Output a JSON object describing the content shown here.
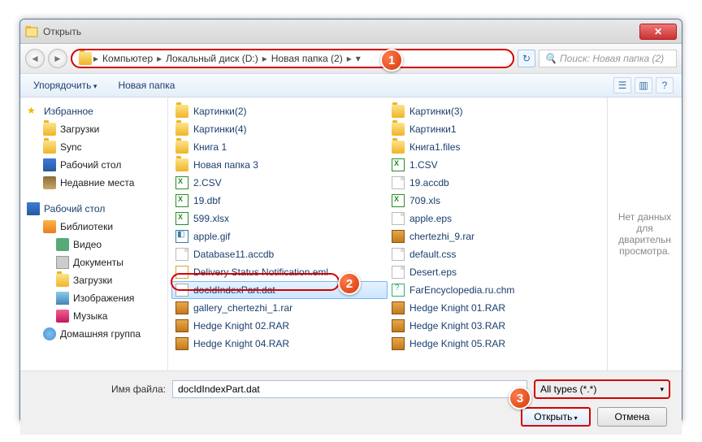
{
  "window": {
    "title": "Открыть"
  },
  "nav": {
    "crumbs": [
      "Компьютер",
      "Локальный диск (D:)",
      "Новая папка (2)"
    ],
    "search_placeholder": "Поиск: Новая папка (2)"
  },
  "toolbar": {
    "organize": "Упорядочить",
    "newfolder": "Новая папка"
  },
  "sidebar": {
    "fav": "Избранное",
    "fav_items": [
      "Загрузки",
      "Sync",
      "Рабочий стол",
      "Недавние места"
    ],
    "desktop": "Рабочий стол",
    "libs": "Библиотеки",
    "lib_items": [
      "Видео",
      "Документы",
      "Загрузки",
      "Изображения",
      "Музыка"
    ],
    "homegroup": "Домашняя группа"
  },
  "files": {
    "col1": [
      {
        "n": "Картинки(2)",
        "t": "folder"
      },
      {
        "n": "Картинки(4)",
        "t": "folder"
      },
      {
        "n": "Книга 1",
        "t": "folder"
      },
      {
        "n": "Новая папка 3",
        "t": "folder"
      },
      {
        "n": "2.CSV",
        "t": "xls"
      },
      {
        "n": "19.dbf",
        "t": "xls"
      },
      {
        "n": "599.xlsx",
        "t": "xls"
      },
      {
        "n": "apple.gif",
        "t": "gif"
      },
      {
        "n": "Database11.accdb",
        "t": "file"
      },
      {
        "n": "Delivery Status Notification.eml",
        "t": "eml"
      },
      {
        "n": "docIdIndexPart.dat",
        "t": "dat",
        "sel": true
      },
      {
        "n": "gallery_chertezhi_1.rar",
        "t": "rar"
      },
      {
        "n": "Hedge Knight 02.RAR",
        "t": "rar"
      },
      {
        "n": "Hedge Knight 04.RAR",
        "t": "rar"
      }
    ],
    "col2": [
      {
        "n": "Картинки(3)",
        "t": "folder"
      },
      {
        "n": "Картинки1",
        "t": "folder"
      },
      {
        "n": "Книга1.files",
        "t": "folder"
      },
      {
        "n": "1.CSV",
        "t": "xls"
      },
      {
        "n": "19.accdb",
        "t": "file"
      },
      {
        "n": "709.xls",
        "t": "xls"
      },
      {
        "n": "apple.eps",
        "t": "file"
      },
      {
        "n": "chertezhi_9.rar",
        "t": "rar"
      },
      {
        "n": "default.css",
        "t": "file"
      },
      {
        "n": "Desert.eps",
        "t": "file"
      },
      {
        "n": "FarEncyclopedia.ru.chm",
        "t": "chm"
      },
      {
        "n": "Hedge Knight 01.RAR",
        "t": "rar"
      },
      {
        "n": "Hedge Knight 03.RAR",
        "t": "rar"
      },
      {
        "n": "Hedge Knight 05.RAR",
        "t": "rar"
      }
    ]
  },
  "preview": {
    "text": "Нет данных для дварительн просмотра."
  },
  "footer": {
    "filename_label": "Имя файла:",
    "filename_value": "docIdIndexPart.dat",
    "filter": "All types (*.*)",
    "open": "Открыть",
    "cancel": "Отмена"
  },
  "callouts": {
    "c1": "1",
    "c2": "2",
    "c3": "3"
  }
}
